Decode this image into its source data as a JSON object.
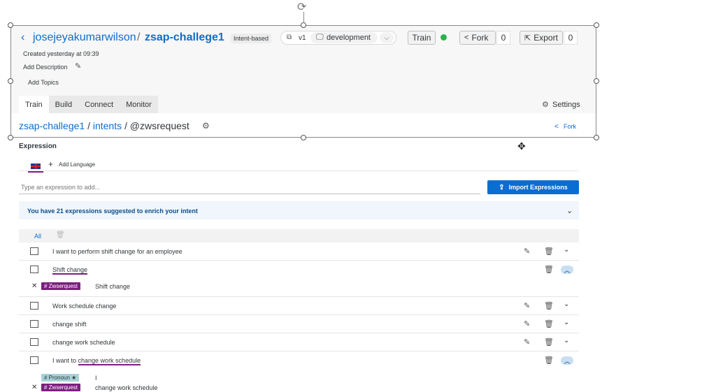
{
  "header": {
    "owner": "josejeyakumarwilson",
    "separator": "/",
    "bot_name": "zsap-challege1",
    "bot_type": "Intent-based",
    "version": "v1",
    "environment": "development",
    "train_label": "Train",
    "train_status_color": "#2bb24c",
    "fork_label": "Fork",
    "fork_count": "0",
    "export_label": "Export",
    "export_count": "0",
    "created": "Created yesterday at 09:39",
    "add_description": "Add Description",
    "add_topics": "Add Topics"
  },
  "tabs": [
    {
      "label": "Train"
    },
    {
      "label": "Build"
    },
    {
      "label": "Connect"
    },
    {
      "label": "Monitor"
    }
  ],
  "settings_label": "Settings",
  "breadcrumb": {
    "bot": "zsap-challege1",
    "sep1": "/",
    "intents": "intents",
    "sep2": "/",
    "intent": "@zwsrequest"
  },
  "fork_link": "Fork",
  "expression_heading": "Expression",
  "add_language": "Add Language",
  "expression_input": {
    "placeholder": "Type an expression to add..."
  },
  "import_button": "Import Expressions",
  "suggestion_banner": "You have 21 expressions suggested to enrich your intent",
  "filter_all": "All",
  "expressions": [
    {
      "text": "I want to perform shift change for an employee"
    },
    {
      "text": "Shift change"
    },
    {
      "text": "Work schedule change"
    },
    {
      "text": "change shift"
    },
    {
      "text": "change work schedule"
    },
    {
      "text_prefix": "I want to ",
      "text_tagged": "change work schedule"
    }
  ],
  "annotations": {
    "shift_change": {
      "tag": "# Zwserquest",
      "value": "Shift change"
    },
    "pronoun": {
      "tag": "# Pronoun ★",
      "value": "I"
    },
    "change_work_schedule": {
      "tag": "# Zwserquest",
      "value": "change work schedule"
    }
  },
  "colors": {
    "brand_blue": "#0a6ed1",
    "entity_purple": "#7b1f7f",
    "pronoun_teal": "#a8d3d8",
    "import_button_bg": "#0a6ed1"
  }
}
